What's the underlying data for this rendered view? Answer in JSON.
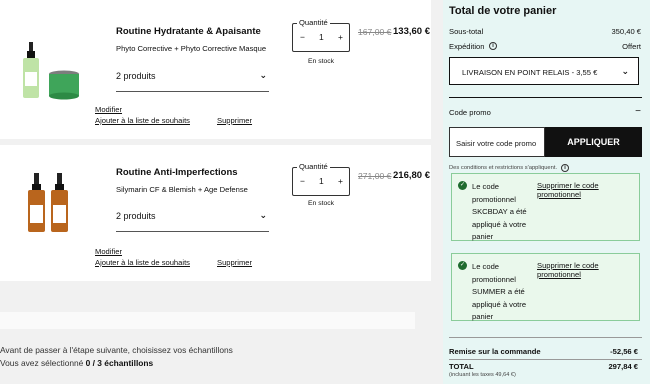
{
  "items": [
    {
      "title": "Routine Hydratante & Apaisante",
      "subtitle": "Phyto Corrective + Phyto Corrective Masque",
      "variant": "2 produits",
      "qty_label": "Quantité",
      "qty": "1",
      "stock": "En stock",
      "old_price": "167,00 €",
      "price": "133,60 €",
      "modify": "Modifier",
      "wishlist": "Ajouter à la liste de souhaits",
      "delete": "Supprimer"
    },
    {
      "title": "Routine Anti-Imperfections",
      "subtitle": "Silymarin CF & Blemish + Age Defense",
      "variant": "2 produits",
      "qty_label": "Quantité",
      "qty": "1",
      "stock": "En stock",
      "old_price": "271,00 €",
      "price": "216,80 €",
      "modify": "Modifier",
      "wishlist": "Ajouter à la liste de souhaits",
      "delete": "Supprimer"
    }
  ],
  "qty_minus": "−",
  "qty_plus": "+",
  "samples": {
    "line1": "Avant de passer à l'étape suivante, choisissez vos échantillons",
    "line2_prefix": "Vous avez sélectionné ",
    "line2_count": "0 / 3 échantillons"
  },
  "panel": {
    "title": "Total de votre panier",
    "subtotal_label": "Sous-total",
    "subtotal_value": "350,40 €",
    "shipping_label": "Expédition",
    "shipping_value": "Offert",
    "shipping_option": "LIVRAISON EN POINT RELAIS - 3,55 €",
    "promo_label": "Code promo",
    "promo_toggle": "−",
    "promo_placeholder": "Saisir votre code promo",
    "apply": "APPLIQUER",
    "conditions": "Des conditions et restrictions s'appliquent.",
    "applied": [
      {
        "text": "Le code promotionnel SKCBDAY a été appliqué à votre panier",
        "remove": "Supprimer le code promotionnel"
      },
      {
        "text": "Le code promotionnel SUMMER a été appliqué à votre panier",
        "remove": "Supprimer le code promotionnel"
      }
    ],
    "discount_label": "Remise sur la commande",
    "discount_value": "-52,56 €",
    "total_label": "TOTAL",
    "total_value": "297,84 €",
    "tax_note": "(incluant les taxes 49,64 €)"
  },
  "colors": {
    "panel_bg": "#e7f6f4",
    "promo_bg": "#eaf8ec",
    "check": "#1f6b2f",
    "button": "#111111"
  },
  "icons": [
    "chevron-down-icon",
    "info-icon",
    "check-circle-icon"
  ]
}
